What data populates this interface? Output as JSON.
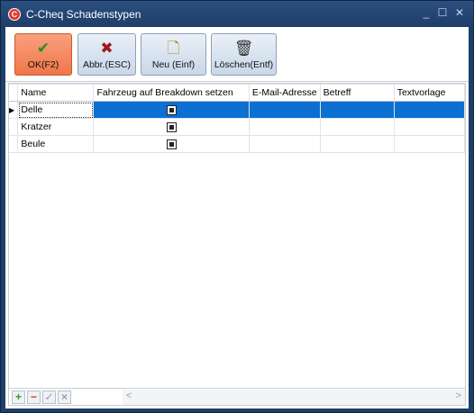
{
  "window": {
    "title": "C-Cheq Schadenstypen",
    "app_icon_letter": "C",
    "controls": {
      "minimize": "_",
      "maximize": "☐",
      "close": "✕"
    }
  },
  "toolbar": {
    "ok": {
      "label": "OK(F2)",
      "icon": "check-icon",
      "glyph": "✔",
      "color": "#1f8f2a"
    },
    "cancel": {
      "label": "Abbr.(ESC)",
      "icon": "cross-icon",
      "glyph": "✖",
      "color": "#a01818"
    },
    "new": {
      "label": "Neu (Einf)",
      "icon": "new-document-icon",
      "glyph": "🗋",
      "color": "#b8860b"
    },
    "delete": {
      "label": "Löschen(Entf)",
      "icon": "trash-icon",
      "glyph": "🗑",
      "color": "#333333"
    }
  },
  "grid": {
    "columns": [
      "Name",
      "Fahrzeug auf Breakdown setzen",
      "E-Mail-Adresse",
      "Betreff",
      "Textvorlage"
    ],
    "rows": [
      {
        "name": "Delle",
        "breakdown": true,
        "email": "",
        "subject": "",
        "template": "",
        "selected": true
      },
      {
        "name": "Kratzer",
        "breakdown": true,
        "email": "",
        "subject": "",
        "template": "",
        "selected": false
      },
      {
        "name": "Beule",
        "breakdown": true,
        "email": "",
        "subject": "",
        "template": "",
        "selected": false
      }
    ],
    "current_row_indicator": "▶"
  },
  "navigator": {
    "add": "+",
    "remove": "−",
    "post": "✓",
    "cancel": "×",
    "scroll_left": "<",
    "scroll_right": ">"
  },
  "colors": {
    "titlebar": "#1f3e68",
    "selection": "#0c6fd2",
    "ok_button": "#f07649"
  }
}
